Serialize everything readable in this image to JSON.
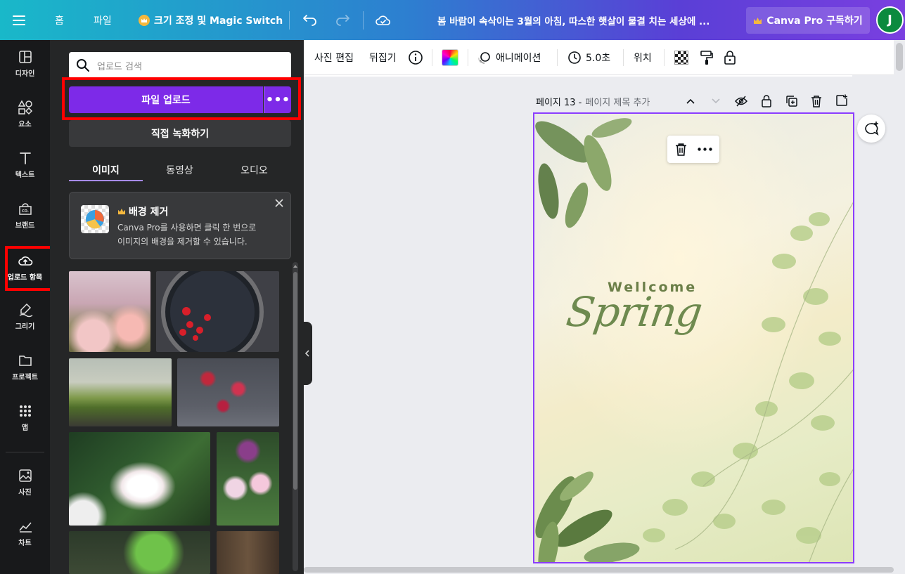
{
  "topbar": {
    "home": "홈",
    "file": "파일",
    "resize": "크기 조정 및 Magic Switch",
    "doc_title": "봄 바람이 속삭이는 3월의 아침, 따스한 햇살이 물결 치는 세상에 ...",
    "pro_button": "Canva Pro 구독하기",
    "avatar_initial": "J"
  },
  "rail": [
    {
      "label": "디자인",
      "icon": "layout-icon"
    },
    {
      "label": "요소",
      "icon": "shapes-icon"
    },
    {
      "label": "텍스트",
      "icon": "text-icon"
    },
    {
      "label": "브랜드",
      "icon": "brand-icon"
    },
    {
      "label": "업로드 항목",
      "icon": "cloud-upload-icon"
    },
    {
      "label": "그리기",
      "icon": "draw-icon"
    },
    {
      "label": "프로젝트",
      "icon": "folder-icon"
    },
    {
      "label": "앱",
      "icon": "apps-grid-icon"
    },
    {
      "label": "사진",
      "icon": "photo-icon"
    },
    {
      "label": "차트",
      "icon": "chart-icon"
    }
  ],
  "panel": {
    "search_placeholder": "업로드 검색",
    "upload_button": "파일 업로드",
    "more_label": "•••",
    "record_button": "직접 녹화하기",
    "tabs": [
      "이미지",
      "동영상",
      "오디오"
    ],
    "promo_title": "배경 제거",
    "promo_text_1": "Canva Pro를 사용하면 클릭 한 번으로",
    "promo_text_2": "이미지의 배경을 제거할 수 있습니다."
  },
  "toolbar": {
    "edit_photo": "사진 편집",
    "flip": "뒤집기",
    "animate": "애니메이션",
    "duration": "5.0초",
    "position": "위치"
  },
  "page": {
    "number": "페이지 13 -",
    "title_placeholder": "페이지 제목 추가",
    "heading_small": "Wellcome",
    "heading_large": "Spring"
  },
  "colors": {
    "accent_purple": "#7d2ae8",
    "highlight_red": "#ff0000",
    "selection_border": "#8b3dff"
  }
}
